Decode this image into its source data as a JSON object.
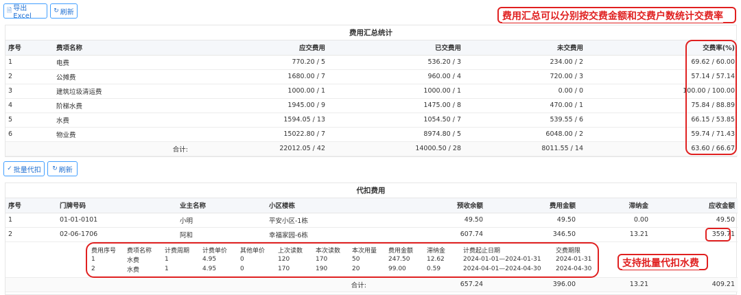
{
  "toolbar1": {
    "export_label": "导出Excel",
    "refresh_label": "刷新"
  },
  "annotation1": "费用汇总可以分别按交费金额和交费户数统计交费率",
  "summary": {
    "title": "费用汇总统计",
    "headers": [
      "序号",
      "费项名称",
      "应交费用",
      "已交费用",
      "未交费用",
      "交费率(%)"
    ],
    "rows": [
      [
        "1",
        "电费",
        "770.20 / 5",
        "536.20 / 3",
        "234.00 / 2",
        "69.62 / 60.00"
      ],
      [
        "2",
        "公摊费",
        "1680.00 / 7",
        "960.00 / 4",
        "720.00 / 3",
        "57.14 / 57.14"
      ],
      [
        "3",
        "建筑垃圾清运费",
        "1000.00 / 1",
        "1000.00 / 1",
        "0.00 / 0",
        "100.00 / 100.00"
      ],
      [
        "4",
        "阶梯水费",
        "1945.00 / 9",
        "1475.00 / 8",
        "470.00 / 1",
        "75.84 / 88.89"
      ],
      [
        "5",
        "水费",
        "1594.05 / 13",
        "1054.50 / 7",
        "539.55 / 6",
        "66.15 / 53.85"
      ],
      [
        "6",
        "物业费",
        "15022.80 / 7",
        "8974.80 / 5",
        "6048.00 / 2",
        "59.74 / 71.43"
      ]
    ],
    "total_label": "合计:",
    "totals": [
      "22012.05 / 42",
      "14000.50 / 28",
      "8011.55 / 14",
      "63.60 / 66.67"
    ]
  },
  "toolbar2": {
    "batch_label": "批量代扣",
    "refresh_label": "刷新"
  },
  "deduct": {
    "title": "代扣费用",
    "headers": [
      "序号",
      "门牌号码",
      "业主名称",
      "小区楼栋",
      "预收余额",
      "费用金额",
      "滞纳金",
      "应收金额"
    ],
    "rows": [
      [
        "1",
        "01-01-0101",
        "小明",
        "平安小区-1栋",
        "49.50",
        "49.50",
        "0.00",
        "49.50"
      ],
      [
        "2",
        "02-06-1706",
        "阿和",
        "幸福家园-6栋",
        "607.74",
        "346.50",
        "13.21",
        "359.71"
      ]
    ],
    "detail_headers": [
      "费用序号",
      "费项名称",
      "计费周期",
      "计费单价",
      "其他单价",
      "上次读数",
      "本次读数",
      "本次用量",
      "费用金额",
      "滞纳金",
      "计费起止日期",
      "交费期限"
    ],
    "detail_rows": [
      [
        "1",
        "水费",
        "1",
        "4.95",
        "0",
        "120",
        "170",
        "50",
        "247.50",
        "12.62",
        "2024-01-01—2024-01-31",
        "2024-01-31"
      ],
      [
        "2",
        "水费",
        "1",
        "4.95",
        "0",
        "170",
        "190",
        "20",
        "99.00",
        "0.59",
        "2024-04-01—2024-04-30",
        "2024-04-30"
      ]
    ],
    "total_label": "合计:",
    "totals": [
      "657.24",
      "396.00",
      "13.21",
      "409.21"
    ]
  },
  "annotation2": "支持批量代扣水费",
  "colors": {
    "accent": "#409eff",
    "annotation": "#e02020"
  }
}
